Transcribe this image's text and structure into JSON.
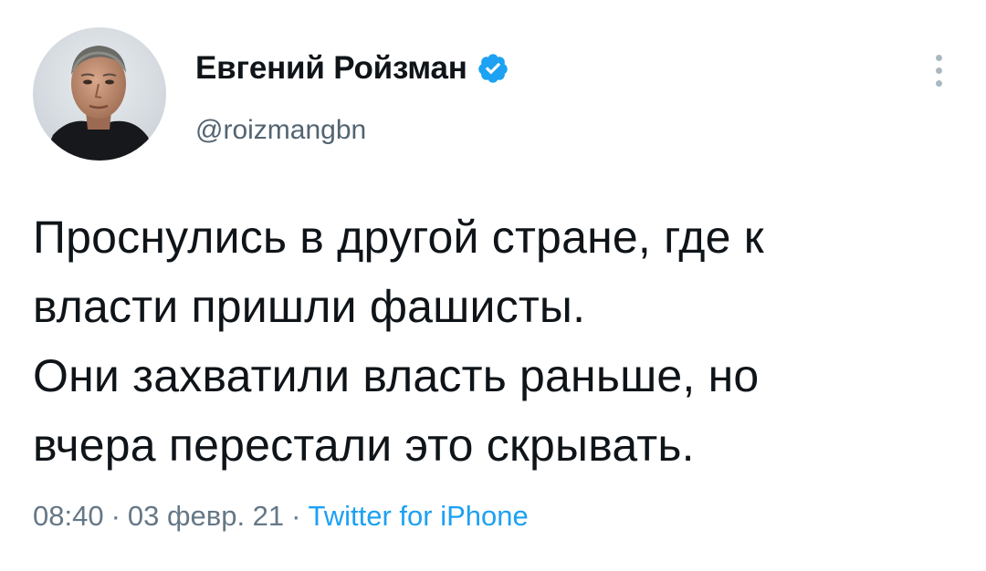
{
  "author": {
    "display_name": "Евгений Ройзман",
    "handle": "@roizmangbn",
    "verified": true
  },
  "tweet": {
    "lines": [
      "Проснулись в другой стране, где к",
      "власти пришли фашисты.",
      "Они захватили власть раньше, но",
      "вчера перестали это скрывать."
    ],
    "time": "08:40",
    "date": "03 февр. 21",
    "separator": "·",
    "source": "Twitter for iPhone"
  },
  "icons": {
    "verified": "verified-badge-icon",
    "more": "more-options-icon"
  },
  "colors": {
    "text": "#0f1419",
    "secondary": "#657786",
    "accent": "#1da1f2"
  }
}
